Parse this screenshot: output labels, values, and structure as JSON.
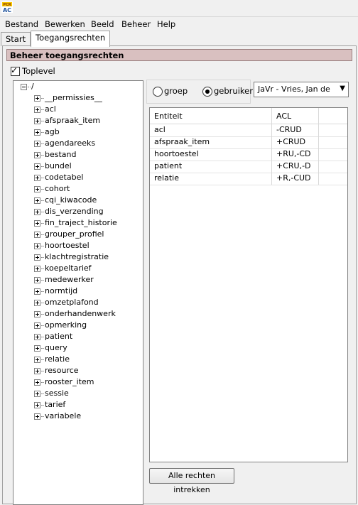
{
  "app": {
    "logo_text_top": "PCR",
    "logo_text_bottom": "AC"
  },
  "menubar": [
    {
      "label": "Bestand"
    },
    {
      "label": "Bewerken"
    },
    {
      "label": "Beeld"
    },
    {
      "label": "Beheer"
    },
    {
      "label": "Help"
    }
  ],
  "tabs": [
    {
      "label": "Start",
      "active": false
    },
    {
      "label": "Toegangsrechten",
      "active": true
    }
  ],
  "panel": {
    "title": "Beheer toegangsrechten",
    "toplevel": {
      "label": "Toplevel",
      "checked": true
    }
  },
  "tree": {
    "root": "/",
    "items": [
      "__permissies__",
      "acl",
      "afspraak_item",
      "agb",
      "agendareeks",
      "bestand",
      "bundel",
      "codetabel",
      "cohort",
      "cqi_kiwacode",
      "dis_verzending",
      "fin_traject_historie",
      "grouper_profiel",
      "hoortoestel",
      "klachtregistratie",
      "koepeltarief",
      "medewerker",
      "normtijd",
      "omzetplafond",
      "onderhandenwerk",
      "opmerking",
      "patient",
      "query",
      "relatie",
      "resource",
      "rooster_item",
      "sessie",
      "tarief",
      "variabele"
    ]
  },
  "radio": {
    "groep": {
      "label": "groep",
      "selected": false
    },
    "gebruiker": {
      "label": "gebruiker",
      "selected": true
    }
  },
  "user_select": {
    "value": "JaVr - Vries, Jan de"
  },
  "grid": {
    "headers": [
      "Entiteit",
      "ACL"
    ],
    "rows": [
      {
        "entity": "acl",
        "acl": "-CRUD"
      },
      {
        "entity": "afspraak_item",
        "acl": "+CRUD"
      },
      {
        "entity": "hoortoestel",
        "acl": "+RU,-CD"
      },
      {
        "entity": "patient",
        "acl": "+CRU,-D"
      },
      {
        "entity": "relatie",
        "acl": "+R,-CUD"
      }
    ]
  },
  "buttons": {
    "revoke_all": "Alle rechten intrekken"
  }
}
